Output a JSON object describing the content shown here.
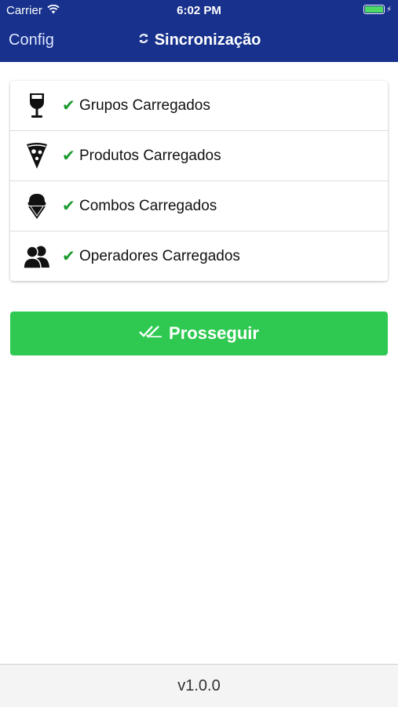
{
  "status_bar": {
    "carrier": "Carrier",
    "time": "6:02 PM"
  },
  "nav": {
    "back_label": "Config",
    "title": "Sincronização",
    "title_icon": "refresh-icon",
    "background": "#17318c"
  },
  "sync_items": [
    {
      "icon": "wine-glass-icon",
      "label": "Grupos Carregados"
    },
    {
      "icon": "pizza-slice-icon",
      "label": "Produtos Carregados"
    },
    {
      "icon": "ice-cream-icon",
      "label": "Combos Carregados"
    },
    {
      "icon": "users-icon",
      "label": "Operadores Carregados"
    }
  ],
  "check_color": "#1a9a2e",
  "proceed_button": {
    "label": "Prosseguir",
    "icon": "double-check-icon",
    "color": "#2fc952"
  },
  "footer": {
    "version": "v1.0.0"
  }
}
